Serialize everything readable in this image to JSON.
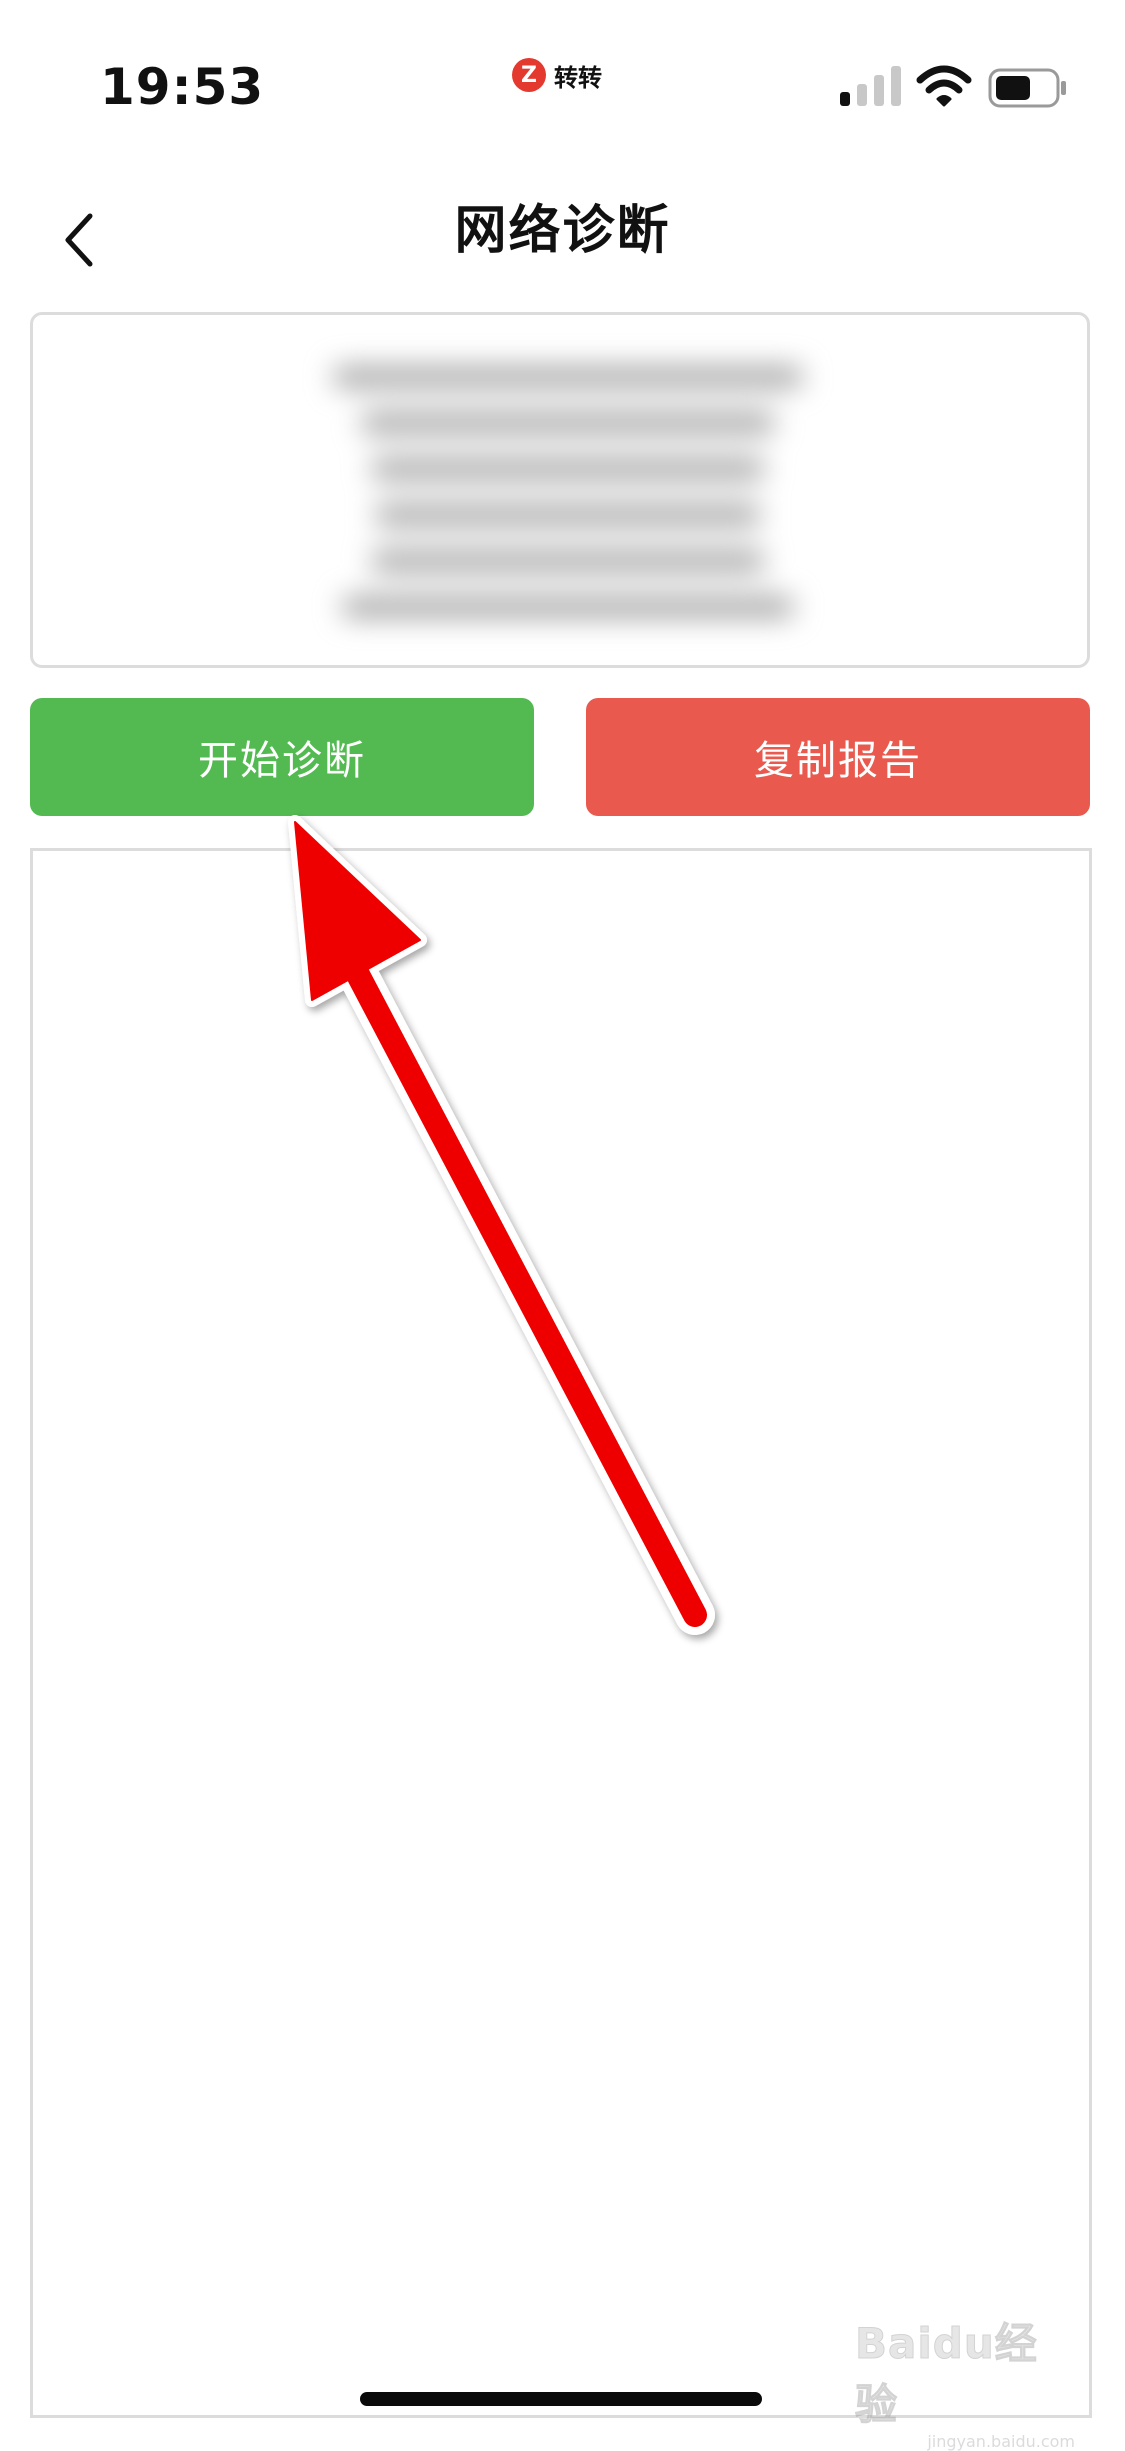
{
  "status_bar": {
    "time": "19:53",
    "carrier_logo": "Z",
    "carrier_name": "转转",
    "icons": [
      "signal-icon",
      "wifi-icon",
      "battery-icon"
    ]
  },
  "nav": {
    "back_icon": "chevron-left-icon",
    "title": "网络诊断"
  },
  "info_panel": {
    "content_blurred": true
  },
  "buttons": {
    "start_label": "开始诊断",
    "copy_label": "复制报告"
  },
  "colors": {
    "start_button": "#53b951",
    "copy_button": "#e9594d",
    "annotation_arrow": "#ff0000"
  },
  "annotation": {
    "icon": "red-arrow-icon",
    "points_to": "开始诊断"
  },
  "watermark": {
    "brand": "Baidu经验",
    "url": "jingyan.baidu.com"
  }
}
